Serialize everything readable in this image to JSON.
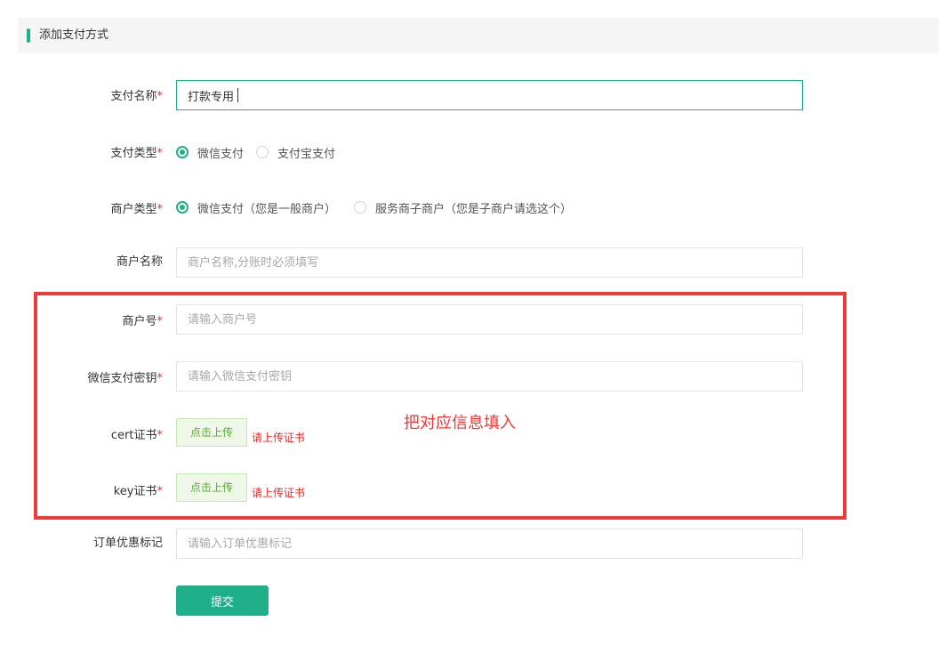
{
  "section": {
    "title": "添加支付方式"
  },
  "required_mark": "*",
  "form": {
    "pay_name": {
      "label": "支付名称",
      "value": "打款专用"
    },
    "pay_type": {
      "label": "支付类型",
      "options": [
        "微信支付",
        "支付宝支付"
      ],
      "selected": "微信支付"
    },
    "merchant_type": {
      "label": "商户类型",
      "options": [
        "微信支付（您是一般商户）",
        "服务商子商户（您是子商户请选这个）"
      ],
      "selected": "微信支付（您是一般商户）"
    },
    "merchant_name": {
      "label": "商户名称",
      "placeholder": "商户名称,分账时必须填写"
    },
    "merchant_id": {
      "label": "商户号",
      "placeholder": "请输入商户号"
    },
    "wechat_key": {
      "label": "微信支付密钥",
      "placeholder": "请输入微信支付密钥"
    },
    "cert": {
      "label": "cert证书",
      "button": "点击上传",
      "hint": "请上传证书"
    },
    "key_cert": {
      "label": "key证书",
      "button": "点击上传",
      "hint": "请上传证书"
    },
    "order_tag": {
      "label": "订单优惠标记",
      "placeholder": "请输入订单优惠标记"
    },
    "submit_label": "提交"
  },
  "annotation": {
    "text": "把对应信息填入",
    "color": "#ef3a3a"
  },
  "colors": {
    "accent": "#1fb08a",
    "required": "#f02d2d"
  }
}
